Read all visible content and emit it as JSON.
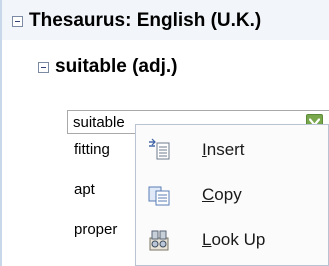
{
  "tree": {
    "root_label": "Thesaurus: English (U.K.)",
    "entry_label": "suitable (adj.)"
  },
  "combo": {
    "value": "suitable"
  },
  "synonyms": [
    "fitting",
    "apt",
    "proper"
  ],
  "context_menu": {
    "items": [
      {
        "label": "Insert",
        "accel": "I",
        "rest": "nsert",
        "icon": "insert-icon"
      },
      {
        "label": "Copy",
        "accel": "C",
        "rest": "opy",
        "icon": "copy-icon"
      },
      {
        "label": "Look Up",
        "accel": "L",
        "rest": "ook Up",
        "icon": "look-up-icon"
      }
    ]
  },
  "colors": {
    "accent_green": "#78a84b",
    "menu_border": "#b9c3d1"
  }
}
